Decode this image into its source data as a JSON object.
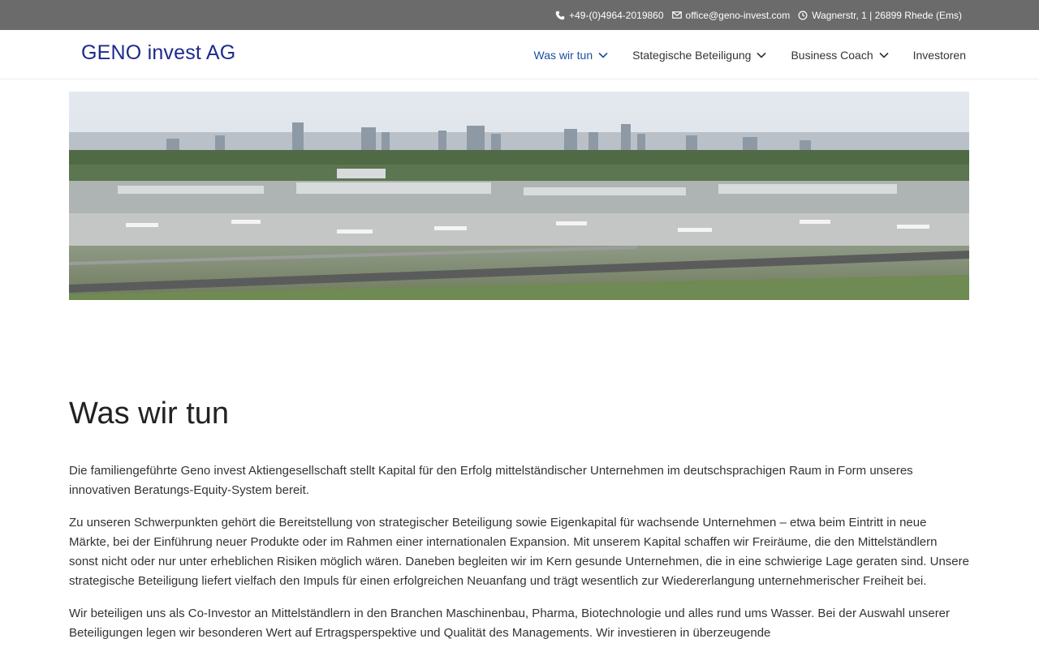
{
  "topbar": {
    "phone": "+49-(0)4964-2019860",
    "email": "office@geno-invest.com",
    "address": "Wagnerstr, 1 | 26899 Rhede (Ems)"
  },
  "header": {
    "logo_text": "GENO invest AG",
    "nav": [
      {
        "label": "Was wir tun",
        "active": true
      },
      {
        "label": "Stategische Beteiligung"
      },
      {
        "label": "Business Coach"
      },
      {
        "label": "Investoren"
      }
    ]
  },
  "main": {
    "title": "Was wir tun",
    "paragraphs": [
      "Die familiengeführte Geno invest Aktiengesellschaft stellt Kapital für den Erfolg mittelständischer Unternehmen im deutschsprachigen Raum in Form unseres innovativen Beratungs-Equity-System bereit.",
      "Zu unseren Schwerpunkten gehört die Bereitstellung von strategischer Beteiligung sowie  Eigenkapital für wachsende Unternehmen – etwa beim Eintritt in neue Märkte, bei der Einführung neuer Produkte oder im Rahmen einer internationalen Expansion. Mit unserem Kapital schaffen wir Freiräume, die den Mittelständlern sonst nicht oder nur unter erheblichen Risiken möglich wären. Daneben begleiten wir im Kern gesunde Unternehmen, die in eine schwierige Lage geraten sind. Unsere strategische Beteiligung liefert vielfach den Impuls für einen erfolgreichen Neuanfang und trägt wesentlich zur Wiedererlangung unternehmerischer Freiheit bei.",
      "Wir beteiligen uns als Co-Investor an Mittelständlern in den Branchen Maschinenbau, Pharma, Biotechnologie und alles rund ums Wasser. Bei der Auswahl unserer Beteiligungen legen wir besonderen Wert auf Ertragsperspektive und Qualität des Managements. Wir investieren in überzeugende"
    ]
  },
  "colors": {
    "topbar_bg": "#6b6b6b",
    "logo": "#1f2a8c",
    "nav_active": "#1a4fa0"
  },
  "icons": {
    "phone": "phone-icon",
    "email": "envelope-icon",
    "address": "clock-icon",
    "dropdown": "chevron-down-icon"
  }
}
